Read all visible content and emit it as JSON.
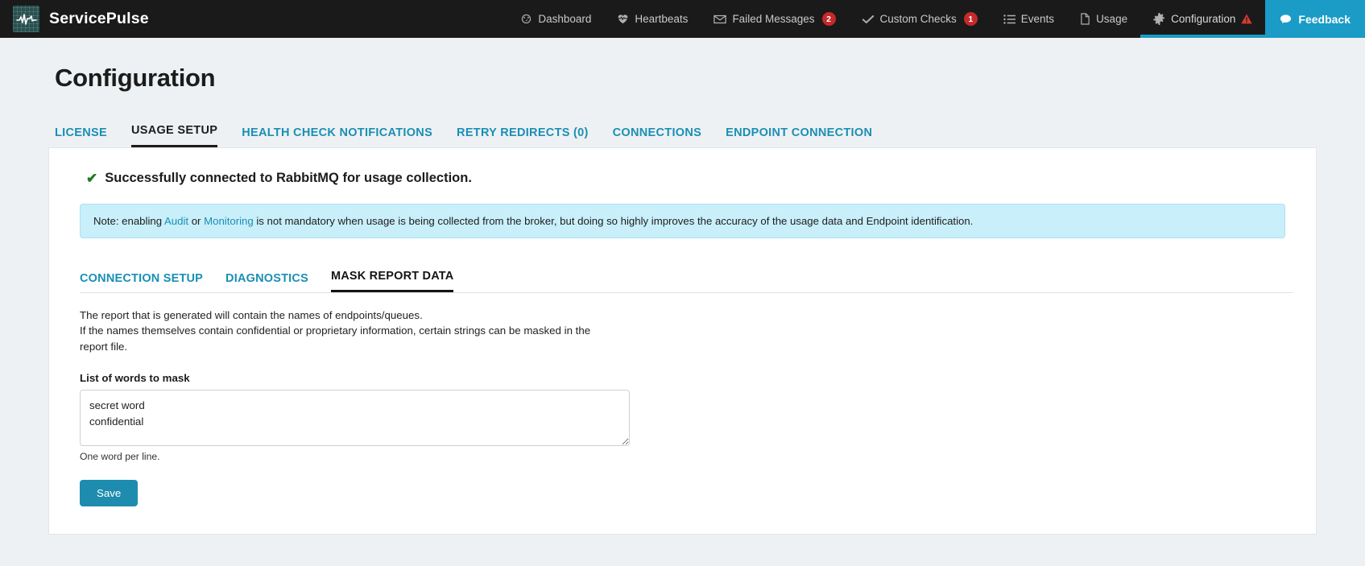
{
  "navbar": {
    "brand": "ServicePulse",
    "logo_icon": "pulse-waveform-icon",
    "items": [
      {
        "label": "Dashboard",
        "icon": "gauge-icon",
        "badge": null,
        "warn": false,
        "active": false
      },
      {
        "label": "Heartbeats",
        "icon": "heartbeat-icon",
        "badge": null,
        "warn": false,
        "active": false
      },
      {
        "label": "Failed Messages",
        "icon": "envelope-icon",
        "badge": "2",
        "warn": false,
        "active": false
      },
      {
        "label": "Custom Checks",
        "icon": "check-icon",
        "badge": "1",
        "warn": false,
        "active": false
      },
      {
        "label": "Events",
        "icon": "list-icon",
        "badge": null,
        "warn": false,
        "active": false
      },
      {
        "label": "Usage",
        "icon": "document-icon",
        "badge": null,
        "warn": false,
        "active": false
      },
      {
        "label": "Configuration",
        "icon": "gear-icon",
        "badge": null,
        "warn": true,
        "active": true
      }
    ],
    "feedback_label": "Feedback",
    "feedback_icon": "speech-bubble-icon",
    "accent_color": "#1a9cc6",
    "badge_color": "#c5292a",
    "warn_color": "#d93b31"
  },
  "page": {
    "title": "Configuration",
    "main_tabs": [
      {
        "label": "LICENSE",
        "active": false
      },
      {
        "label": "USAGE SETUP",
        "active": true
      },
      {
        "label": "HEALTH CHECK NOTIFICATIONS",
        "active": false
      },
      {
        "label": "RETRY REDIRECTS (0)",
        "active": false
      },
      {
        "label": "CONNECTIONS",
        "active": false
      },
      {
        "label": "ENDPOINT CONNECTION",
        "active": false
      }
    ]
  },
  "status": {
    "icon": "check-mark-icon",
    "color": "#1d7a1d",
    "message": "Successfully connected to RabbitMQ for usage collection."
  },
  "note": {
    "prefix": "Note: enabling ",
    "link_audit": "Audit",
    "middle": " or ",
    "link_monitoring": "Monitoring",
    "suffix": " is not mandatory when usage is being collected from the broker, but doing so highly improves the accuracy of the usage data and Endpoint identification.",
    "background_color": "#c9effb",
    "link_color": "#1a8fb5"
  },
  "sub_tabs": [
    {
      "label": "CONNECTION SETUP",
      "active": false
    },
    {
      "label": "DIAGNOSTICS",
      "active": false
    },
    {
      "label": "MASK REPORT DATA",
      "active": true
    }
  ],
  "mask_panel": {
    "description_line1": "The report that is generated will contain the names of endpoints/queues.",
    "description_line2": "If the names themselves contain confidential or proprietary information, certain strings can be masked in the report file.",
    "field_label": "List of words to mask",
    "textarea_value": "secret word\nconfidential",
    "textarea_placeholder": "",
    "hint": "One word per line.",
    "save_label": "Save",
    "save_color": "#1d8cae"
  }
}
